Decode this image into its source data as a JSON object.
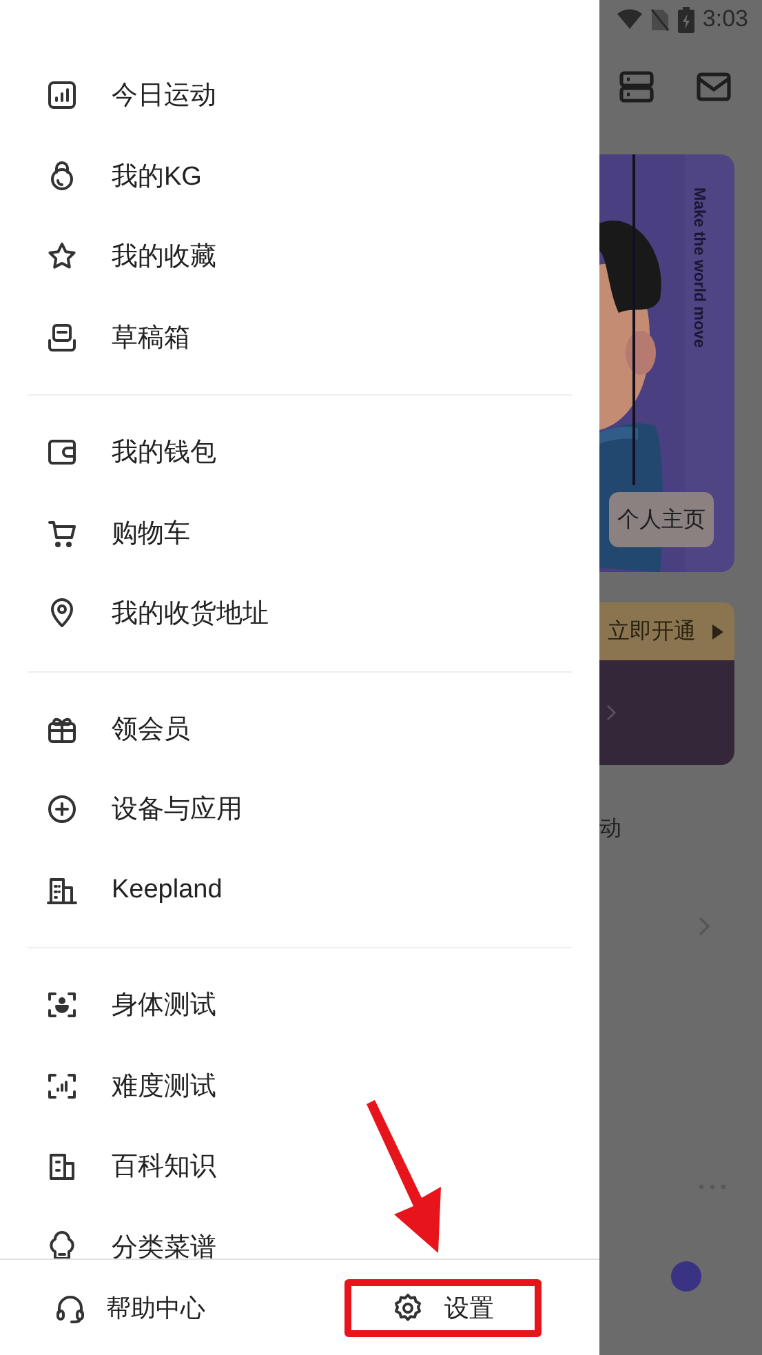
{
  "status_bar": {
    "time": "3:03"
  },
  "background_app": {
    "profile_card": {
      "slogan": "Make the world move",
      "button": "个人主页"
    },
    "membership_banner": {
      "button": "立即开通"
    },
    "section_label": "动"
  },
  "drawer": {
    "groups": [
      [
        {
          "label": "今日运动"
        },
        {
          "label": "我的KG"
        },
        {
          "label": "我的收藏"
        },
        {
          "label": "草稿箱"
        }
      ],
      [
        {
          "label": "我的钱包"
        },
        {
          "label": "购物车"
        },
        {
          "label": "我的收货地址"
        }
      ],
      [
        {
          "label": "领会员"
        },
        {
          "label": "设备与应用"
        },
        {
          "label": "Keepland"
        }
      ],
      [
        {
          "label": "身体测试"
        },
        {
          "label": "难度测试"
        },
        {
          "label": "百科知识"
        },
        {
          "label": "分类菜谱"
        }
      ]
    ],
    "footer": [
      {
        "label": "帮助中心",
        "highlighted": false
      },
      {
        "label": "设置",
        "highlighted": true
      }
    ]
  },
  "annotation": {
    "arrow": true
  }
}
